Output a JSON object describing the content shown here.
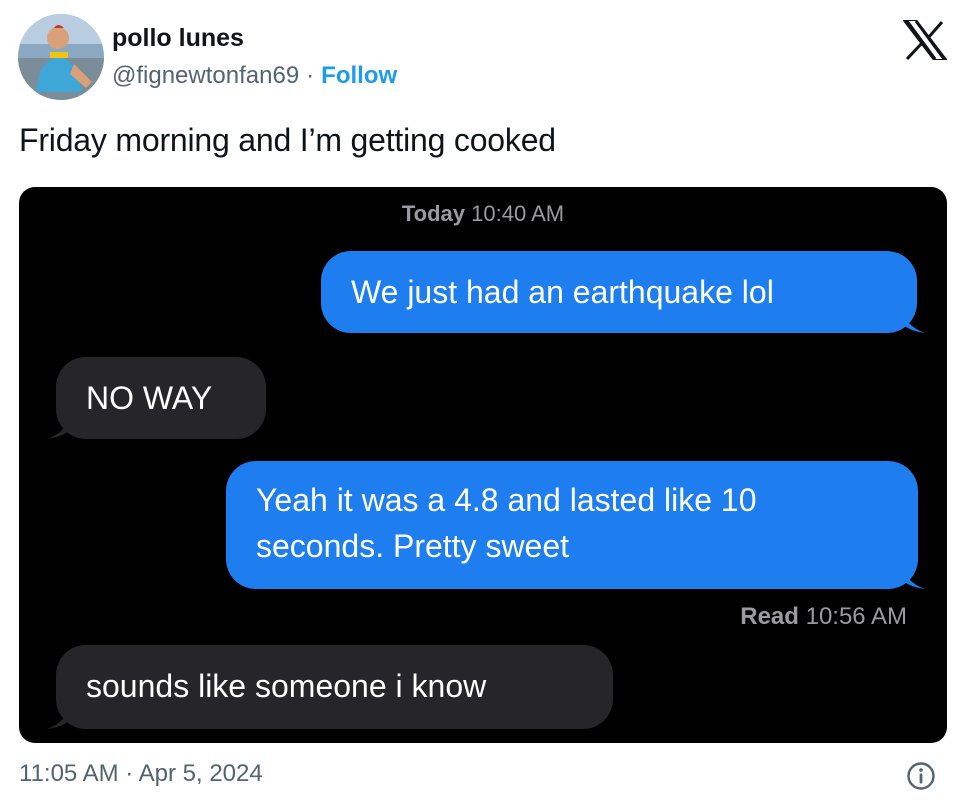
{
  "author": {
    "name": "pollo lunes",
    "handle": "@fignewtonfan69",
    "separator": "·",
    "follow_label": "Follow"
  },
  "tweet": {
    "text": "Friday morning and I’m getting cooked",
    "timestamp": "11:05 AM · Apr 5, 2024"
  },
  "media": {
    "header_day": "Today",
    "header_time": "10:40 AM",
    "messages": [
      {
        "side": "out",
        "text": "We just had an earthquake lol"
      },
      {
        "side": "in",
        "text": "NO WAY"
      },
      {
        "side": "out",
        "text": "Yeah it was a 4.8 and lasted like 10 seconds. Pretty sweet"
      },
      {
        "side": "in",
        "text": "sounds like someone i know"
      }
    ],
    "read_label": "Read",
    "read_time": "10:56 AM"
  },
  "colors": {
    "accent": "#1d9bf0",
    "bubble_out": "#1e7ef0",
    "bubble_in": "#26262a",
    "meta_gray": "#536471"
  },
  "icons": {
    "brand": "x-logo-icon",
    "info": "info-icon"
  }
}
